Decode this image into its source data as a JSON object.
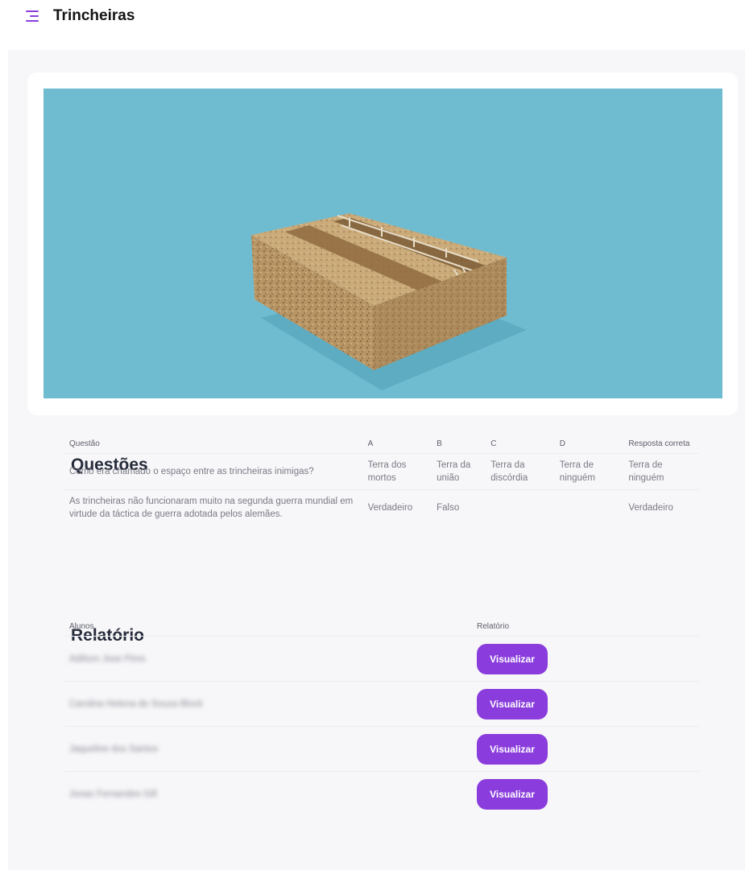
{
  "header": {
    "title": "Trincheiras",
    "menu_icon": "hamburger-icon"
  },
  "colors": {
    "accent": "#8a3ddc",
    "scene_bg": "#6fbcd1"
  },
  "questions": {
    "title": "Questões",
    "columns": [
      "Questão",
      "A",
      "B",
      "C",
      "D",
      "Resposta correta"
    ],
    "rows": [
      [
        "Como era chamado o espaço entre as trincheiras inimigas?",
        "Terra dos mortos",
        "Terra da união",
        "Terra da discórdia",
        "Terra de ninguém",
        "Terra de ninguém"
      ],
      [
        "As trincheiras não funcionaram muito na segunda guerra mundial em virtude da táctica de guerra adotada pelos alemães.",
        "Verdadeiro",
        "Falso",
        "",
        "",
        "Verdadeiro"
      ]
    ]
  },
  "report": {
    "title": "Relatório",
    "columns": [
      "Alunos",
      "Relatório"
    ],
    "button_label": "Visualizar",
    "students": [
      "Adilson Jose Pires",
      "Carolina Helena de Souza Block",
      "Jaqueline dos Santos",
      "Jonas Fernandes Gill"
    ]
  }
}
